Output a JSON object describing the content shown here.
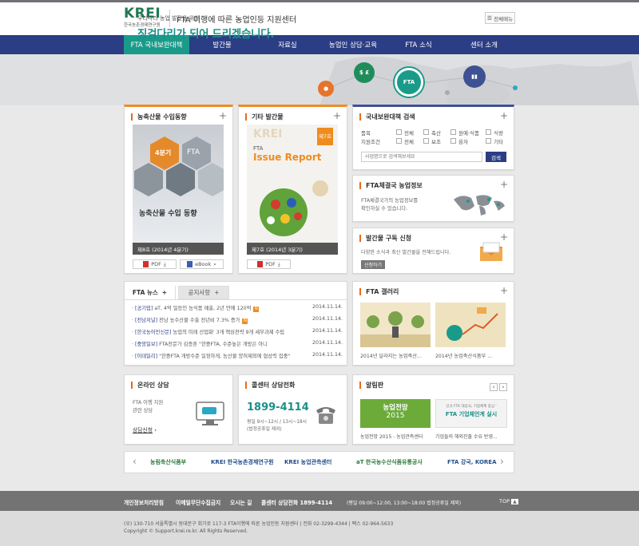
{
  "header": {
    "logo_text": "KREI",
    "logo_sub": "한국농촌경제연구원",
    "site_title": "FTA 이행에 따른 농업인등 지원센터",
    "all_menu": "전체메뉴"
  },
  "nav": {
    "items": [
      "FTA 국내보완대책",
      "발간물",
      "자료실",
      "농업인 상담·교육",
      "FTA 소식",
      "센터 소개"
    ]
  },
  "hero": {
    "subtitle": "우리나라 농업 발전을 위한",
    "headline": "징검다리가 되어 드리겠습니다.",
    "bubble_fta": "FTA",
    "bubble_money": "$ £"
  },
  "import_trend": {
    "title": "농축산물 수입동향",
    "cover_badge": "4분기",
    "cover_title": "농축산물 수입 동향",
    "cover_word": "FTA",
    "caption": "제8호 (2014년 4분기)",
    "pdf": "PDF",
    "ebook": "eBook"
  },
  "other_pubs": {
    "title": "기타 발간물",
    "cover_brand": "KREI",
    "cover_issue": "제7호",
    "cover_title": "Issue Report",
    "cover_word": "FTA",
    "caption": "제7호 (2014년 3분기)",
    "pdf": "PDF"
  },
  "search": {
    "title": "국내보완대책 검색",
    "row1_label": "품목",
    "row1_options": [
      "전체",
      "축산",
      "원예·식품",
      "식량"
    ],
    "row2_label": "지원조건",
    "row2_options": [
      "전체",
      "보조",
      "융자",
      "기타"
    ],
    "placeholder": "사업명으로 검색해보세요",
    "button": "검색"
  },
  "fta_info": {
    "title": "FTA체결국 농업정보",
    "desc1": "FTA체결국가의 농업정보를",
    "desc2": "확인하실 수 있습니다."
  },
  "subscribe": {
    "title": "발간물 구독 신청",
    "desc": "다양한 소식과 최신 발간물을 전해드립니다.",
    "button": "신청하기"
  },
  "news": {
    "tab1": "FTA 뉴스",
    "tab2": "공지사항",
    "items": [
      {
        "src": "[공기업]",
        "text": " aT, 4억 일등인 농식품 매출, 2년 만에 120억",
        "new": "N",
        "date": "2014.11.14."
      },
      {
        "src": "[전남저널]",
        "text": " 전남 농수산물 수출 전년비 7.3% 증가",
        "new": "N",
        "date": "2014.11.14."
      },
      {
        "src": "[한국농어민신문]",
        "text": " 농업의 미래 산업화' 3개 핵심전략 9개 세부과제 수립",
        "new": "",
        "date": "2014.11.14."
      },
      {
        "src": "[중앙일보]",
        "text": " FTA전문가 김종훈 \"한중FTA, 수준높은 개방은 아니",
        "new": "",
        "date": "2014.11.14."
      },
      {
        "src": "[이데일리]",
        "text": " \"한중FTA 개방수준 일정하게, 농산물 양허제외에 협상력 집중\"",
        "new": "",
        "date": "2014.11.14."
      }
    ]
  },
  "gallery": {
    "title": "FTA 갤러리",
    "item1": "2014년 달라지는 농업축산...",
    "item2": "2014년 농업축산식품부 ..."
  },
  "consult": {
    "title": "온라인 상담",
    "desc1": "FTA 이행 지원",
    "desc2": "관련 상담",
    "link": "상담신청"
  },
  "callcenter": {
    "title": "콜센터 상담전화",
    "phone": "1899-4114",
    "hours": "평일 9시~12시 / 13시~18시",
    "note": "(법정공휴일 제외)"
  },
  "notice": {
    "title": "알림판",
    "banner1_title": "농업전망",
    "banner1_year": "2015",
    "banner1_caption": "농업전망 2015 - 농업관측센터",
    "banner2_small": "신규 FTA 대상국, 기업체계 중심 '",
    "banner2_title": "FTA 기업체언계 실시",
    "banner2_caption": "기업들의 해외진출 수요 반영..."
  },
  "partners": [
    "농림축산식품부",
    "KREI 한국농촌경제연구원",
    "KREI 농업관측센터",
    "aT 한국농수산식품유통공사",
    "FTA 강국, KOREA"
  ],
  "footer": {
    "links": [
      "개인정보처리방침",
      "이메일무단수집금지",
      "오시는 길",
      "콜센터 상담전화 1899-4114"
    ],
    "hours_note": "(평일 09:00~12:00, 13:00~18:00 법정공휴일 제외)",
    "top": "TOP",
    "address": "(우) 130-710 서울특별시 동대문구 회기로 117-3  FTA이행에 따른 농업인등 지원센터   |   전화 02-3299-4344   |   팩스 02-964-5633",
    "copyright": "Copyright © Support.krei.re.kr. All Rights Reserved."
  },
  "colors": {
    "nav_bg": "#2b3d84",
    "active": "#1a9b8a",
    "accent_orange": "#ef8c1f",
    "headline_teal": "#1a8f88",
    "logo_green": "#1f7a53"
  }
}
